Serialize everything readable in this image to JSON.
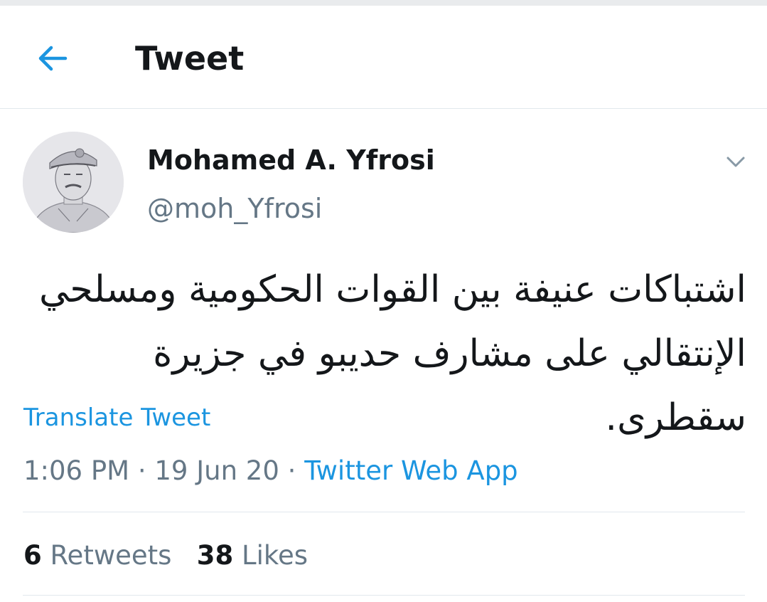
{
  "header": {
    "title": "Tweet",
    "back_icon": "arrow-left-icon"
  },
  "tweet": {
    "author_name": "Mohamed A. Yfrosi",
    "author_handle": "@moh_Yfrosi",
    "more_icon": "chevron-down-icon",
    "text": "اشتباكات عنيفة بين القوات الحكومية ومسلحي الإنتقالي على مشارف حديبو في جزيرة سقطرى.",
    "translate_label": "Translate Tweet",
    "time": "1:06 PM",
    "date": "19 Jun 20",
    "separator": "·",
    "source": "Twitter Web App",
    "retweets_count": "6",
    "retweets_label": "Retweets",
    "likes_count": "38",
    "likes_label": "Likes"
  },
  "colors": {
    "accent": "#1b95e0",
    "secondary_text": "#657786",
    "primary_text": "#14171a",
    "divider": "#e1e8ed"
  }
}
